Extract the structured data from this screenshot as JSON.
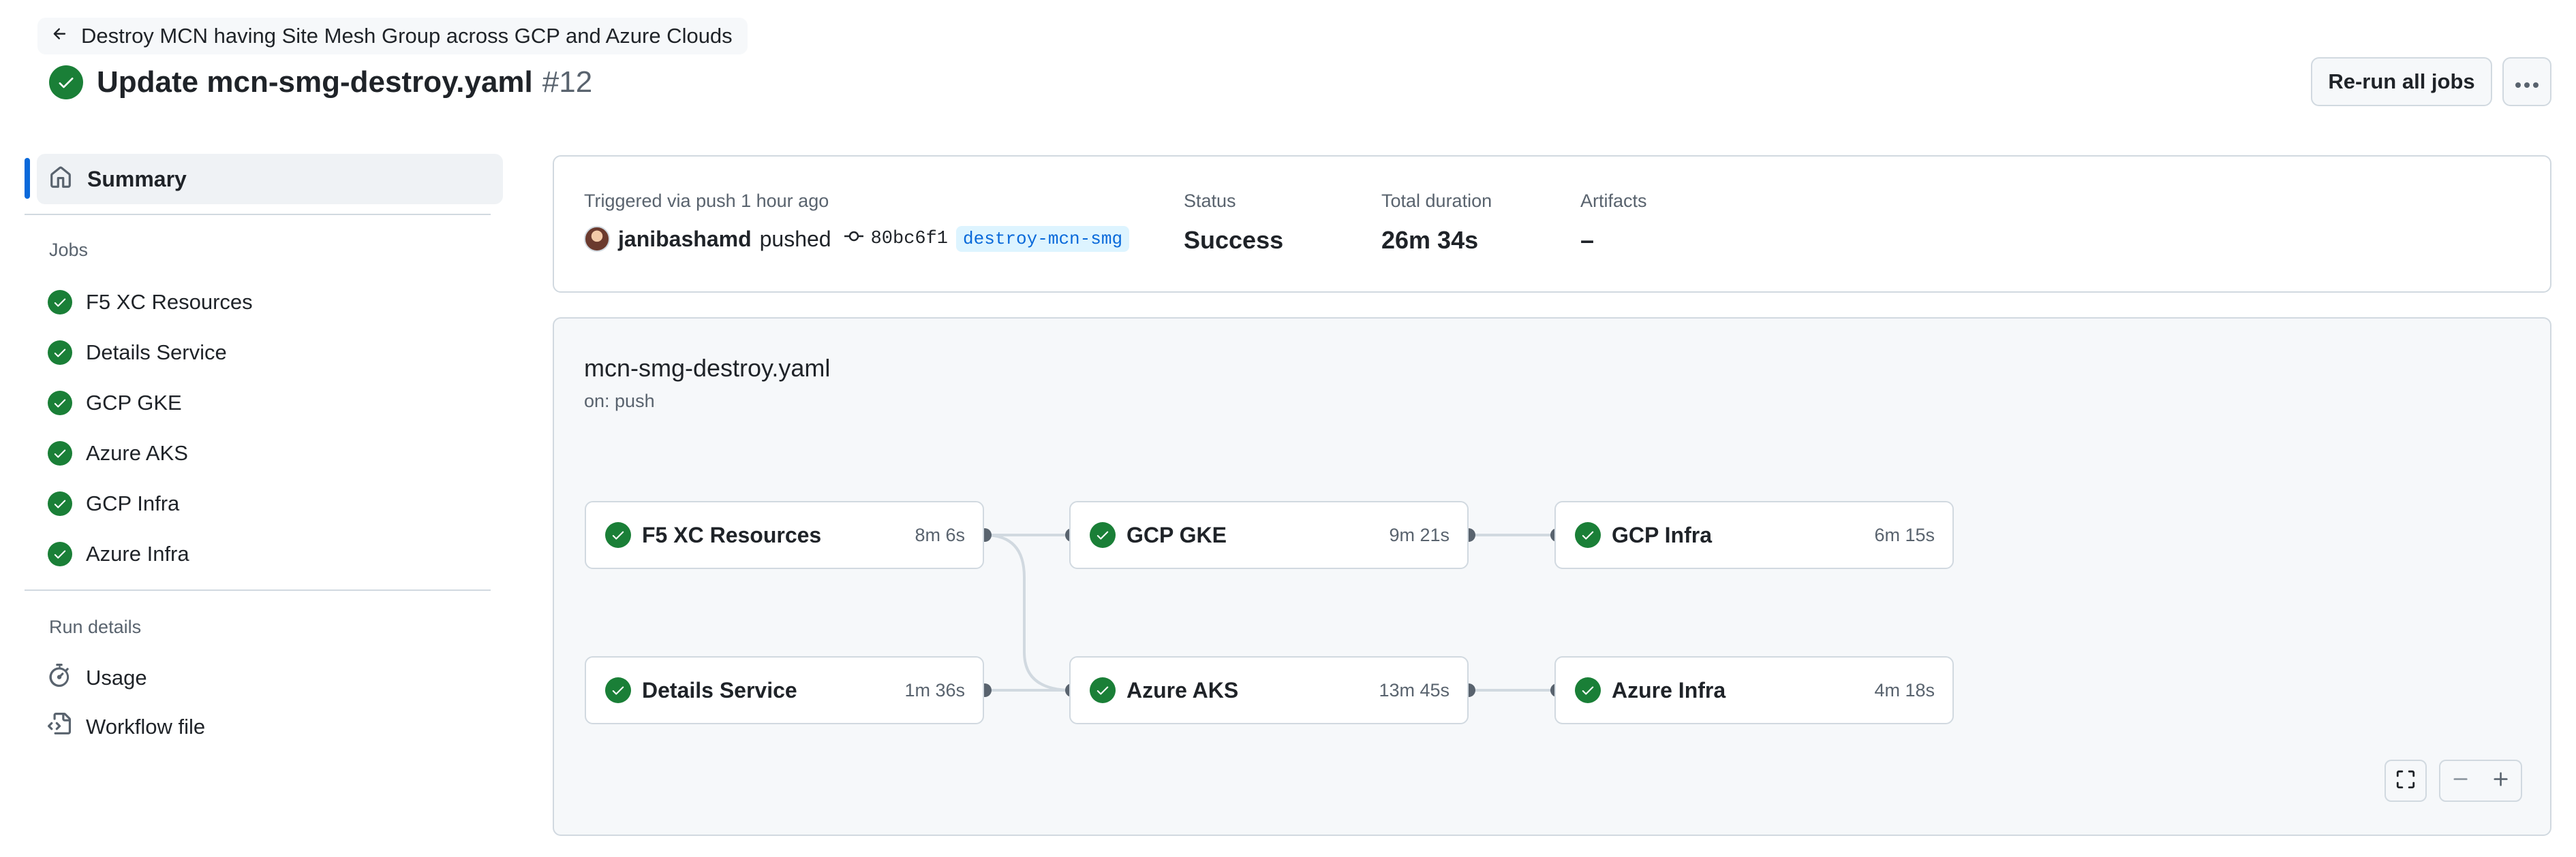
{
  "header": {
    "back_link": "Destroy MCN having Site Mesh Group across GCP and Azure Clouds",
    "title": "Update mcn-smg-destroy.yaml",
    "run_number": "#12",
    "rerun_label": "Re-run all jobs"
  },
  "sidebar": {
    "summary_label": "Summary",
    "jobs_heading": "Jobs",
    "jobs": [
      {
        "label": "F5 XC Resources"
      },
      {
        "label": "Details Service"
      },
      {
        "label": "GCP GKE"
      },
      {
        "label": "Azure AKS"
      },
      {
        "label": "GCP Infra"
      },
      {
        "label": "Azure Infra"
      }
    ],
    "run_details_heading": "Run details",
    "details": [
      {
        "label": "Usage",
        "icon": "stopwatch-icon"
      },
      {
        "label": "Workflow file",
        "icon": "file-code-icon"
      }
    ]
  },
  "summary": {
    "trigger_text": "Triggered via push 1 hour ago",
    "actor": "janibashamd",
    "pushed_word": "pushed",
    "commit": "80bc6f1",
    "branch": "destroy-mcn-smg",
    "status_label": "Status",
    "status_value": "Success",
    "duration_label": "Total duration",
    "duration_value": "26m 34s",
    "artifacts_label": "Artifacts",
    "artifacts_value": "–"
  },
  "graph": {
    "workflow_file": "mcn-smg-destroy.yaml",
    "trigger": "on: push",
    "nodes": [
      {
        "name": "F5 XC Resources",
        "duration": "8m 6s"
      },
      {
        "name": "Details Service",
        "duration": "1m 36s"
      },
      {
        "name": "GCP GKE",
        "duration": "9m 21s"
      },
      {
        "name": "Azure AKS",
        "duration": "13m 45s"
      },
      {
        "name": "GCP Infra",
        "duration": "6m 15s"
      },
      {
        "name": "Azure Infra",
        "duration": "4m 18s"
      }
    ]
  },
  "colors": {
    "success": "#1a7f37",
    "accent": "#0969da"
  }
}
